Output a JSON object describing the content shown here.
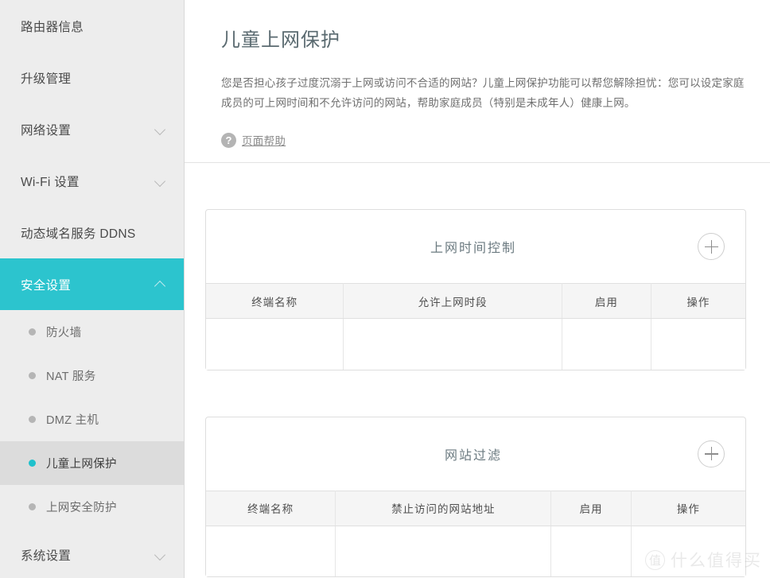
{
  "sidebar": {
    "items": [
      {
        "label": "路由器信息",
        "expandable": false
      },
      {
        "label": "升级管理",
        "expandable": false
      },
      {
        "label": "网络设置",
        "expandable": true
      },
      {
        "label": "Wi-Fi 设置",
        "expandable": true
      },
      {
        "label": "动态域名服务 DDNS",
        "expandable": false
      },
      {
        "label": "安全设置",
        "expandable": true,
        "active": true
      },
      {
        "label": "系统设置",
        "expandable": true
      }
    ],
    "subitems": [
      {
        "label": "防火墙"
      },
      {
        "label": "NAT 服务"
      },
      {
        "label": "DMZ 主机"
      },
      {
        "label": "儿童上网保护",
        "current": true
      },
      {
        "label": "上网安全防护"
      }
    ]
  },
  "header": {
    "title": "儿童上网保护",
    "description": "您是否担心孩子过度沉溺于上网或访问不合适的网站？儿童上网保护功能可以帮您解除担忧：您可以设定家庭成员的可上网时间和不允许访问的网站，帮助家庭成员（特别是未成年人）健康上网。",
    "help_icon": "question-mark-icon",
    "help_link": "页面帮助"
  },
  "panels": [
    {
      "title": "上网时间控制",
      "add_icon": "plus-icon",
      "columns": [
        "终端名称",
        "允许上网时段",
        "启用",
        "操作"
      ],
      "rows": [
        [
          "",
          "",
          "",
          ""
        ]
      ]
    },
    {
      "title": "网站过滤",
      "add_icon": "plus-icon",
      "columns": [
        "终端名称",
        "禁止访问的网站地址",
        "启用",
        "操作"
      ],
      "rows": [
        [
          "",
          "",
          "",
          ""
        ]
      ]
    }
  ],
  "watermark": {
    "logo": "值",
    "text": "什么值得买"
  },
  "colors": {
    "accent": "#2CC4CE",
    "sidebar_bg": "#EDEDED",
    "active_sub_bg": "#DCDCDC"
  }
}
